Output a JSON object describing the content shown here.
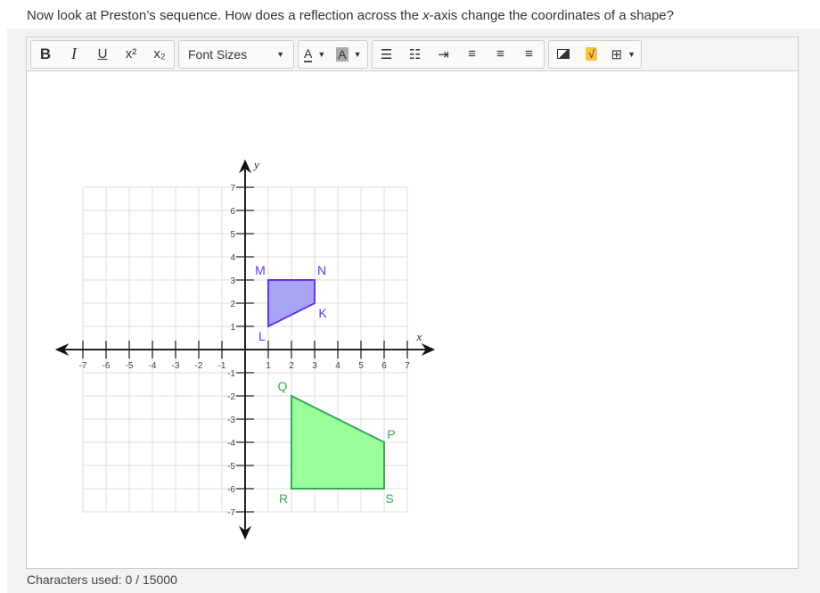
{
  "question": {
    "before": "Now look at Preston’s sequence. How does a reflection across the ",
    "italic": "x",
    "after": "-axis change the coordinates of a shape?"
  },
  "toolbar": {
    "bold": "B",
    "italic": "I",
    "underline": "U",
    "superscript": "x²",
    "subscript": "x₂",
    "font_sizes": "Font Sizes",
    "font_color": "A",
    "highlight": "A"
  },
  "footer": {
    "label": "Characters used: 0 / 15000"
  },
  "colors": {
    "purple_fill": "#aaa4f5",
    "purple_stroke": "#6633ee",
    "green_fill": "#99ff99",
    "green_stroke": "#33aa55"
  },
  "chart_data": {
    "type": "scatter",
    "xlabel": "x",
    "ylabel": "y",
    "xlim": [
      -7,
      7
    ],
    "ylim": [
      -7,
      7
    ],
    "grid": true,
    "x_ticks": [
      -7,
      -6,
      -5,
      -4,
      -3,
      -2,
      -1,
      1,
      2,
      3,
      4,
      5,
      6,
      7
    ],
    "y_ticks": [
      7,
      6,
      5,
      4,
      3,
      2,
      1,
      -1,
      -2,
      -3,
      -4,
      -5,
      -6,
      -7
    ],
    "shapes": [
      {
        "name": "KLMN",
        "color": "purple",
        "vertices": [
          {
            "label": "M",
            "x": 1,
            "y": 3
          },
          {
            "label": "N",
            "x": 3,
            "y": 3
          },
          {
            "label": "K",
            "x": 3,
            "y": 2
          },
          {
            "label": "L",
            "x": 1,
            "y": 1
          }
        ]
      },
      {
        "name": "PQRS",
        "color": "green",
        "vertices": [
          {
            "label": "Q",
            "x": 2,
            "y": -2
          },
          {
            "label": "P",
            "x": 6,
            "y": -4
          },
          {
            "label": "S",
            "x": 6,
            "y": -6
          },
          {
            "label": "R",
            "x": 2,
            "y": -6
          }
        ]
      }
    ]
  }
}
